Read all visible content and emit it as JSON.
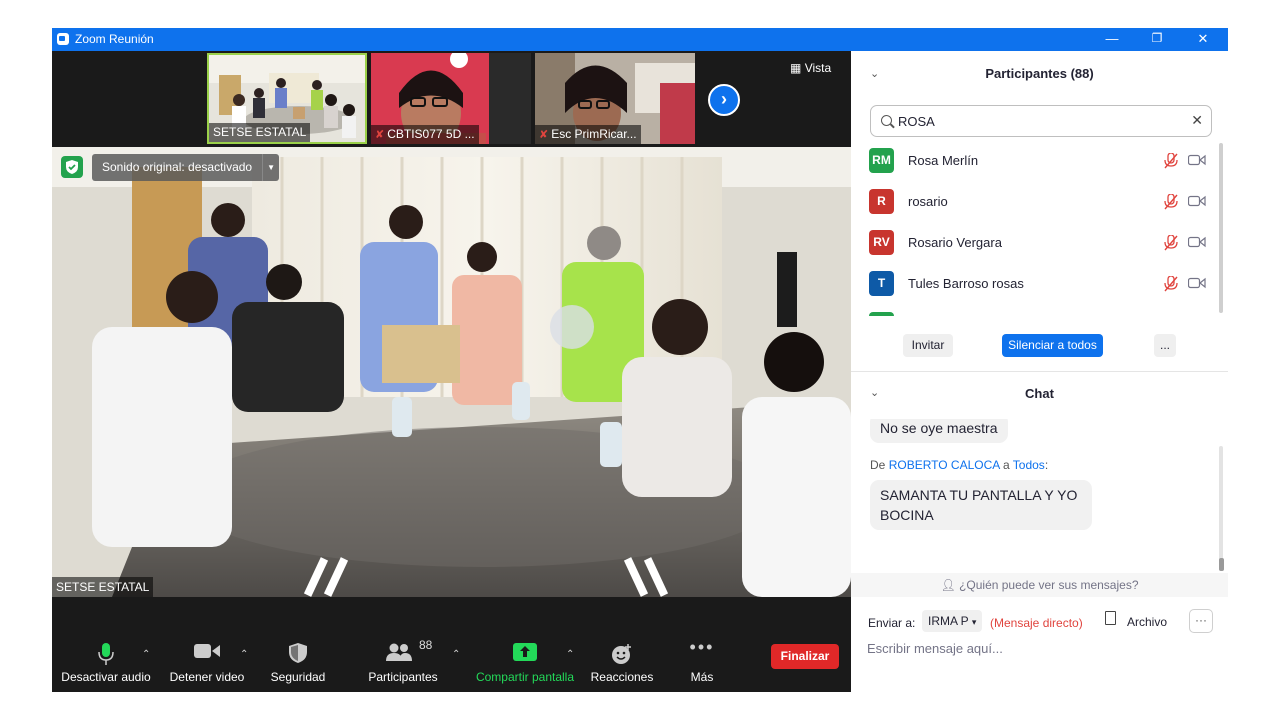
{
  "window": {
    "title": "Zoom Reunión",
    "minimize": "—",
    "maximize": "❐",
    "close": "✕"
  },
  "thumbnails": [
    {
      "name": "SETSE ESTATAL",
      "muted": false
    },
    {
      "name": "CBTIS077 5D ...",
      "muted": true
    },
    {
      "name": "Esc PrimRicar...",
      "muted": true
    }
  ],
  "view_button": "Vista",
  "original_sound": "Sonido original: desactivado",
  "main_speaker": "SETSE ESTATAL",
  "toolbar": {
    "mute_label": "Desactivar audio",
    "video_label": "Detener video",
    "security_label": "Seguridad",
    "participants_label": "Participantes",
    "participants_count": "88",
    "share_label": "Compartir pantalla",
    "reactions_label": "Reacciones",
    "more_label": "Más",
    "end_label": "Finalizar"
  },
  "participants_panel": {
    "title": "Participantes (88)",
    "search_value": "ROSA",
    "participants": [
      {
        "initials": "RM",
        "name": "Rosa Merlín",
        "color": "#23a24d"
      },
      {
        "initials": "R",
        "name": "rosario",
        "color": "#c8352e"
      },
      {
        "initials": "RV",
        "name": "Rosario Vergara",
        "color": "#c8352e"
      },
      {
        "initials": "T",
        "name": "Tules Barroso rosas",
        "color": "#0e5aa7"
      }
    ],
    "invite_label": "Invitar",
    "mute_all_label": "Silenciar a todos",
    "more_label": "..."
  },
  "chat": {
    "title": "Chat",
    "messages": [
      {
        "text": "No se oye maestra"
      },
      {
        "from_prefix": "De",
        "from": "ROBERTO CALOCA",
        "to_word": "a",
        "to": "Todos",
        "suffix": ":",
        "text": "SAMANTA TU PANTALLA Y YO BOCINA"
      }
    ],
    "who_can_see": "¿Quién puede ver sus mensajes?",
    "send_to_label": "Enviar a:",
    "recipient": "IRMA P",
    "direct_label": "(Mensaje directo)",
    "file_label": "Archivo",
    "more_label": "···",
    "input_placeholder": "Escribir mensaje aquí..."
  },
  "colors": {
    "zoom_blue": "#0e72ed",
    "end_red": "#e02828",
    "share_green": "#23d959",
    "dark_bg": "#1a1a1a"
  }
}
